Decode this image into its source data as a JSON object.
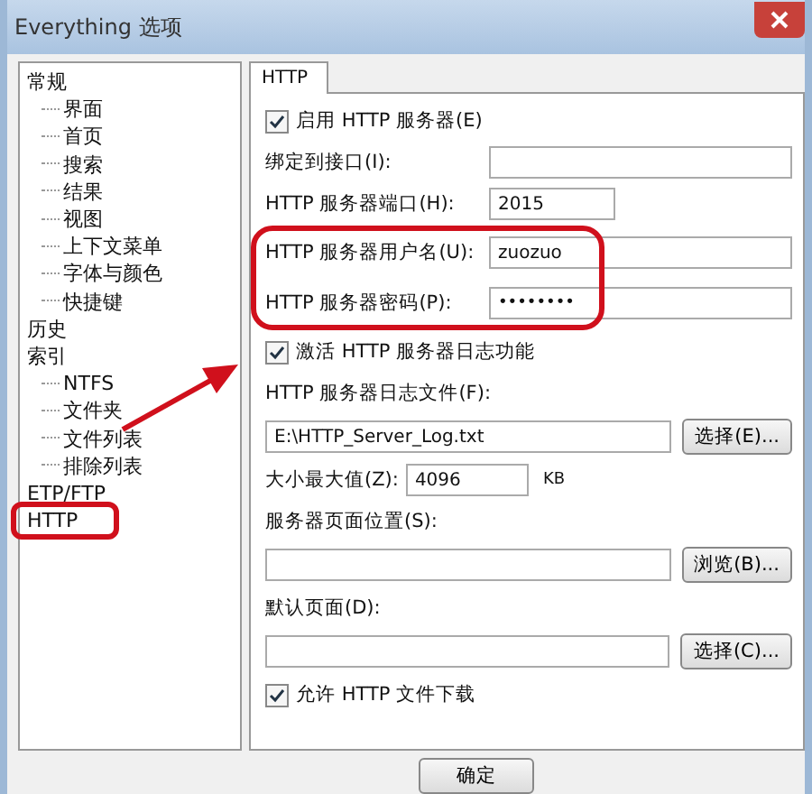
{
  "window": {
    "title": "Everything 选项"
  },
  "tree": [
    {
      "label": "常规",
      "children": [
        {
          "label": "界面"
        },
        {
          "label": "首页"
        },
        {
          "label": "搜索"
        },
        {
          "label": "结果"
        },
        {
          "label": "视图"
        },
        {
          "label": "上下文菜单"
        },
        {
          "label": "字体与颜色"
        },
        {
          "label": "快捷键"
        }
      ]
    },
    {
      "label": "历史"
    },
    {
      "label": "索引",
      "children": [
        {
          "label": "NTFS"
        },
        {
          "label": "文件夹"
        },
        {
          "label": "文件列表"
        },
        {
          "label": "排除列表"
        }
      ]
    },
    {
      "label": "ETP/FTP"
    },
    {
      "label": "HTTP",
      "circled": true
    }
  ],
  "tab": {
    "label": "HTTP"
  },
  "settings": [
    {
      "kind": "checkbox",
      "label": "启用 HTTP 服务器(E)",
      "checked": true
    },
    {
      "kind": "field",
      "label": "绑定到接口(I):"
    },
    {
      "kind": "short_field",
      "label": "HTTP 服务器端口(H):",
      "value": "2015"
    },
    {
      "kind": "field",
      "label": "HTTP 服务器用户名(U):",
      "value": "zuozuo",
      "circled": true
    },
    {
      "kind": "password",
      "label": "HTTP 服务器密码(P):",
      "value": "••••••••",
      "circled": true
    },
    {
      "kind": "checkbox",
      "label": "激活 HTTP 服务器日志功能",
      "checked": true
    },
    {
      "kind": "label",
      "label": "HTTP 服务器日志文件(F):"
    },
    {
      "kind": "file",
      "value": "E:\\HTTP_Server_Log.txt",
      "button": "选择(E)..."
    },
    {
      "kind": "size",
      "label": "大小最大值(Z):",
      "value": "4096",
      "unit": "KB"
    },
    {
      "kind": "label",
      "label": "服务器页面位置(S):"
    },
    {
      "kind": "file",
      "button": "浏览(B)..."
    },
    {
      "kind": "label",
      "label": "默认页面(D):"
    },
    {
      "kind": "file",
      "button": "选择(C)..."
    },
    {
      "kind": "checkbox",
      "label": "允许 HTTP 文件下载",
      "checked": true
    }
  ],
  "buttons": [
    {
      "label": "确定"
    }
  ]
}
